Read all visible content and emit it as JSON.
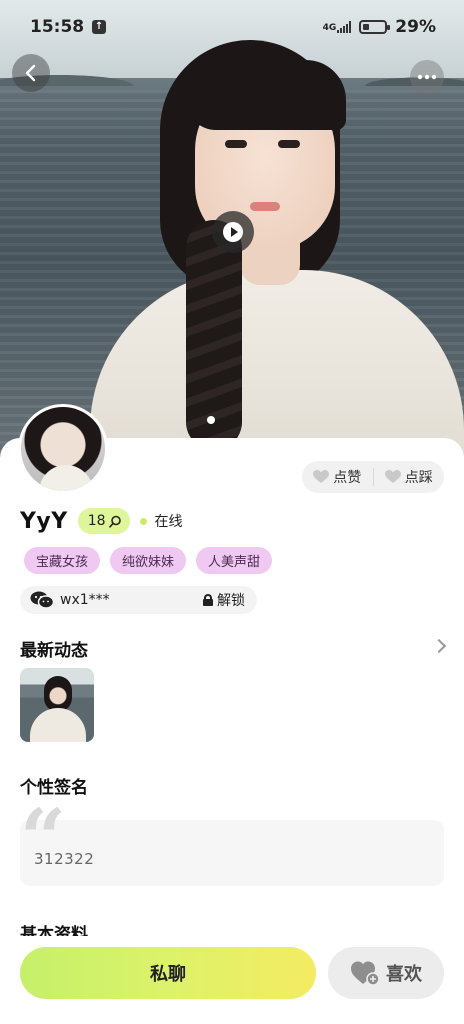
{
  "status_bar": {
    "time": "15:58",
    "network": "4G",
    "battery_percent": "29%",
    "battery_level": 0.29
  },
  "profile": {
    "name": "YyY",
    "age": "18",
    "online_status": "在线",
    "tags": [
      "宝藏女孩",
      "纯欲妹妹",
      "人美声甜"
    ],
    "wechat_id": "wx1***",
    "unlock_label": "解锁"
  },
  "actions": {
    "like_label": "点赞",
    "dislike_label": "点踩"
  },
  "sections": {
    "latest_title": "最新动态",
    "signature_title": "个性签名",
    "signature_text": "312322",
    "basic_info_title": "基本资料"
  },
  "bottom_bar": {
    "chat_label": "私聊",
    "favorite_label": "喜欢"
  },
  "colors": {
    "accent_green": "#dff59a",
    "tag_pink": "#efc9f1",
    "chat_gradient_start": "#c6f06a",
    "chat_gradient_end": "#f4ec62"
  }
}
